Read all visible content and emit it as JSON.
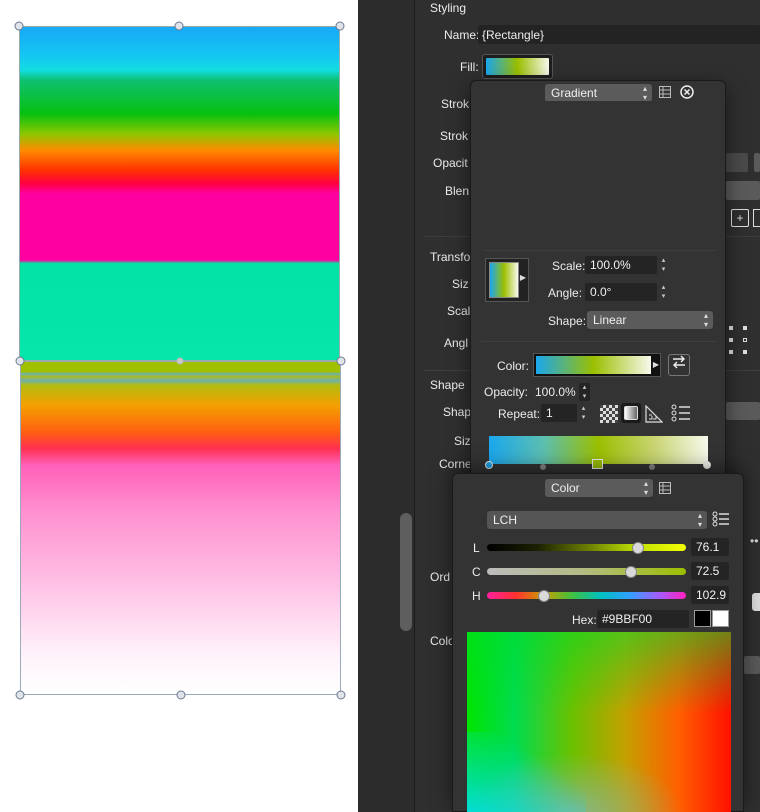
{
  "styling": {
    "title": "Styling",
    "name_label": "Name:",
    "name_value": "{Rectangle}",
    "fill_label": "Fill:",
    "stroke_label": "Strok",
    "stroke2_label": "Strok",
    "opacity_label": "Opacit",
    "blend_label": "Blen"
  },
  "transform": {
    "title": "Transfo",
    "size_label": "Siz",
    "scale_label": "Scal",
    "angle_label": "Angl"
  },
  "shape": {
    "title": "Shape",
    "shape_label": "Shap",
    "size_label": "Siz",
    "corner_label": "Corne"
  },
  "order": {
    "title": "Ord"
  },
  "color_section": {
    "title": "Colo"
  },
  "gradient_popover": {
    "type_value": "Gradient",
    "scale_label": "Scale:",
    "scale_value": "100.0%",
    "angle_label": "Angle:",
    "angle_value": "0.0°",
    "shape_label": "Shape:",
    "shape_value": "Linear",
    "color_label": "Color:",
    "opacity_label": "Opacity:",
    "opacity_value": "100.0%",
    "repeat_label": "Repeat:",
    "repeat_value": "1"
  },
  "color_popover": {
    "type_value": "Color",
    "model_value": "LCH",
    "l_label": "L",
    "l_value": "76.1",
    "l_level": 0.761,
    "c_label": "C",
    "c_value": "72.5",
    "c_level": 0.725,
    "h_label": "H",
    "h_value": "102.9",
    "h_level": 0.286,
    "hex_label": "Hex:",
    "hex_value": "#9BBF00"
  },
  "colors": {
    "panel_bg": "#2f2f2f",
    "selected_color": "#9BBF00",
    "gradient_start": "#1aa7ee",
    "gradient_end": "#f7f9ec"
  },
  "icons": [
    "list-view-icon",
    "close-icon",
    "swap-icon",
    "checkerboard-icon",
    "gradient-icon",
    "pattern-icon",
    "stops-list-icon"
  ]
}
